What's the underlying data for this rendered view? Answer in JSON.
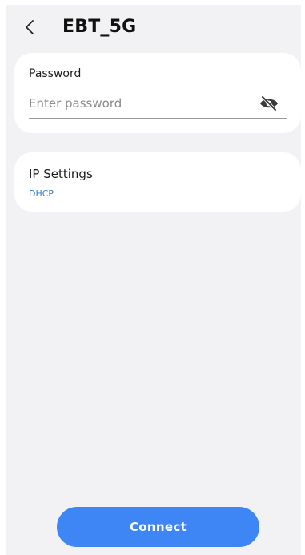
{
  "header": {
    "title": "EBT_5G",
    "back_icon": "chevron-left-icon"
  },
  "password": {
    "label": "Password",
    "placeholder": "Enter password",
    "value": "",
    "visibility_icon": "eye-off-icon"
  },
  "ip_settings": {
    "label": "IP Settings",
    "value": "DHCP"
  },
  "connect_button": {
    "label": "Connect"
  },
  "colors": {
    "background": "#f2f2f4",
    "card": "#ffffff",
    "accent": "#3e86f5",
    "link": "#3a7cc7"
  }
}
